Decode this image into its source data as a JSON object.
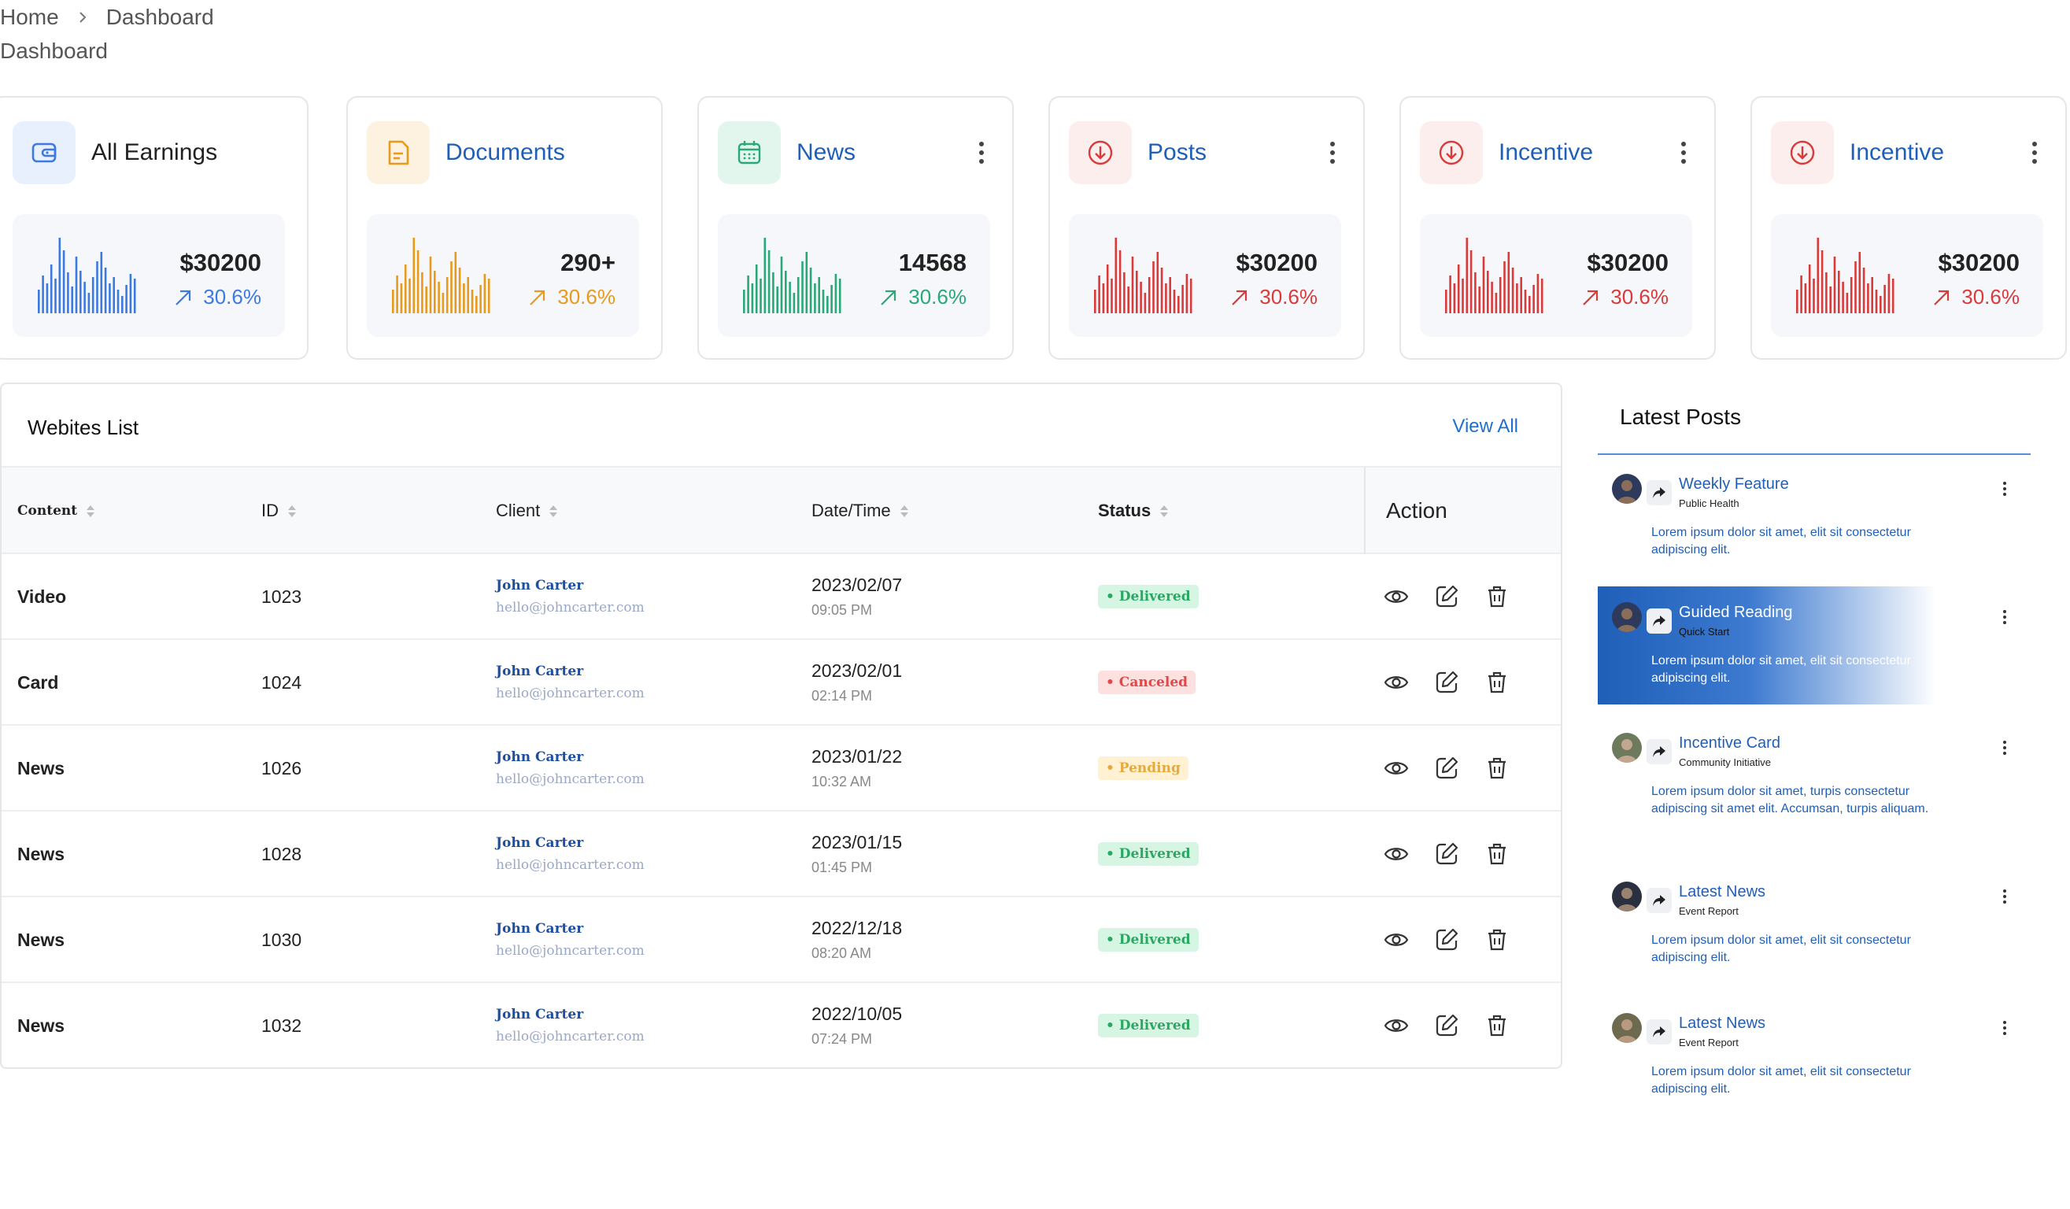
{
  "breadcrumb": {
    "home": "Home",
    "current": "Dashboard"
  },
  "page_title": "Dashboard",
  "cards": [
    {
      "title": "All Earnings",
      "value": "$30200",
      "change": "30.6%",
      "color": "#3d7ae0",
      "icon_bg": "#e8f0fd",
      "icon": "wallet-icon"
    },
    {
      "title": "Documents",
      "value": "290+",
      "change": "30.6%",
      "color": "#e89a1c",
      "icon_bg": "#fdf1e0",
      "icon": "document-icon"
    },
    {
      "title": "News",
      "value": "14568",
      "change": "30.6%",
      "color": "#2aa877",
      "icon_bg": "#e3f6ee",
      "icon": "calendar-icon"
    },
    {
      "title": "Posts",
      "value": "$30200",
      "change": "30.6%",
      "color": "#d93a3a",
      "icon_bg": "#fdeeee",
      "icon": "download-circle-icon"
    },
    {
      "title": "Incentive",
      "value": "$30200",
      "change": "30.6%",
      "color": "#d93a3a",
      "icon_bg": "#fdeeee",
      "icon": "download-circle-icon"
    },
    {
      "title": "Incentive",
      "value": "$30200",
      "change": "30.6%",
      "color": "#d93a3a",
      "icon_bg": "#fdeeee",
      "icon": "download-circle-icon"
    }
  ],
  "websites": {
    "title": "Webites List",
    "view_all": "View All",
    "columns": {
      "content": "Content",
      "id": "ID",
      "client": "Client",
      "datetime": "Date/Time",
      "status": "Status",
      "action": "Action"
    },
    "rows": [
      {
        "content": "Video",
        "id": "1023",
        "client_name": "John Carter",
        "client_email": "hello@johncarter.com",
        "date": "2023/02/07",
        "time": "09:05 PM",
        "status": "• Delivered"
      },
      {
        "content": "Card",
        "id": "1024",
        "client_name": "John Carter",
        "client_email": "hello@johncarter.com",
        "date": "2023/02/01",
        "time": "02:14 PM",
        "status": "• Canceled"
      },
      {
        "content": "News",
        "id": "1026",
        "client_name": "John Carter",
        "client_email": "hello@johncarter.com",
        "date": "2023/01/22",
        "time": "10:32 AM",
        "status": "• Pending"
      },
      {
        "content": "News",
        "id": "1028",
        "client_name": "John Carter",
        "client_email": "hello@johncarter.com",
        "date": "2023/01/15",
        "time": "01:45 PM",
        "status": "• Delivered"
      },
      {
        "content": "News",
        "id": "1030",
        "client_name": "John Carter",
        "client_email": "hello@johncarter.com",
        "date": "2022/12/18",
        "time": "08:20 AM",
        "status": "• Delivered"
      },
      {
        "content": "News",
        "id": "1032",
        "client_name": "John Carter",
        "client_email": "hello@johncarter.com",
        "date": "2022/10/05",
        "time": "07:24 PM",
        "status": "• Delivered"
      }
    ]
  },
  "latest_posts": {
    "title": "Latest Posts",
    "items": [
      {
        "title": "Weekly Feature",
        "subtitle": "Public Health",
        "text": "Lorem ipsum dolor sit amet, elit sit consectetur adipiscing elit."
      },
      {
        "title": "Guided Reading",
        "subtitle": "Quick Start",
        "text": "Lorem ipsum dolor sit amet, elit sit consectetur adipiscing elit."
      },
      {
        "title": "Incentive Card",
        "subtitle": "Community Initiative",
        "text": "Lorem ipsum dolor sit amet, turpis  consectetur adipiscing sit amet elit. Accumsan, turpis aliquam."
      },
      {
        "title": "Latest News",
        "subtitle": "Event Report",
        "text": "Lorem ipsum dolor sit amet, elit sit consectetur adipiscing elit."
      },
      {
        "title": "Latest News",
        "subtitle": "Event Report",
        "text": "Lorem ipsum dolor sit amet, elit sit consectetur adipiscing elit."
      }
    ]
  }
}
